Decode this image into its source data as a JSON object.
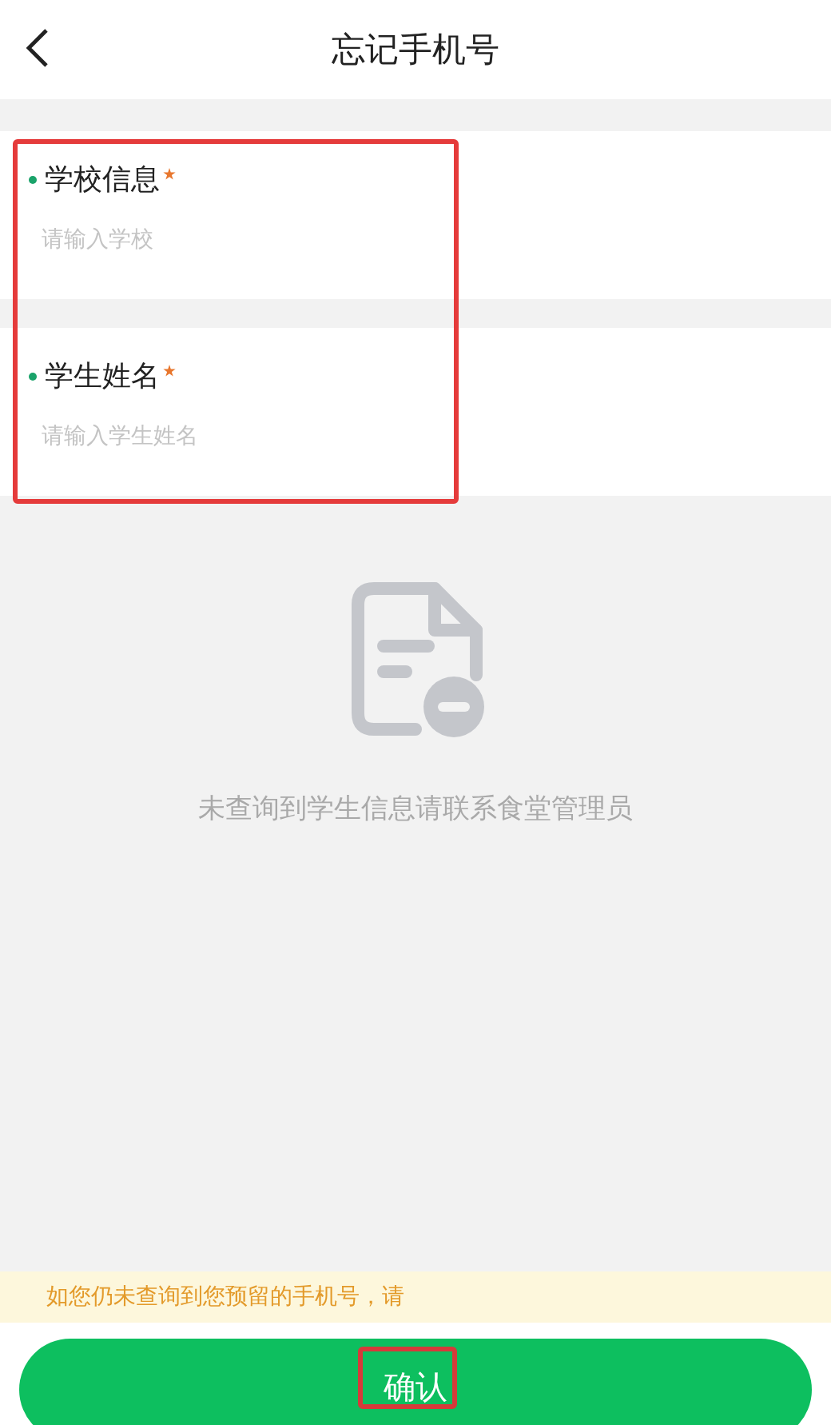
{
  "header": {
    "title": "忘记手机号"
  },
  "form": {
    "highlighted": true,
    "fields": [
      {
        "label": "学校信息",
        "required": true,
        "placeholder": "请输入学校"
      },
      {
        "label": "学生姓名",
        "required": true,
        "placeholder": "请输入学生姓名"
      }
    ]
  },
  "empty_state": {
    "message": "未查询到学生信息请联系食堂管理员"
  },
  "notice": "如您仍未查询到您预留的手机号，请",
  "confirm_button": {
    "label": "确认",
    "highlighted": true
  }
}
